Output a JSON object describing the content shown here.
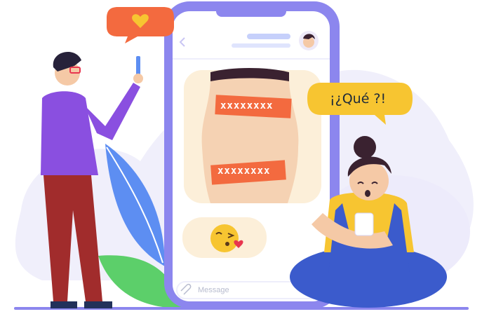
{
  "scene": {
    "phone": {
      "message_placeholder": "Message",
      "censor_banners": [
        "xxxxxxxx",
        "xxxxxxxx"
      ],
      "emoji": "kiss-emoji"
    },
    "speech_bubbles": {
      "girl_text": "¡¿Qué ?!",
      "man_icon": "heart-icon"
    },
    "colors": {
      "phone_frame": "#8c86ee",
      "screen_bg": "#ffffff",
      "censor_bar": "#f36a3f",
      "speech_girl": "#f7c531",
      "speech_man": "#f36a3f",
      "heart": "#f7c531"
    }
  }
}
